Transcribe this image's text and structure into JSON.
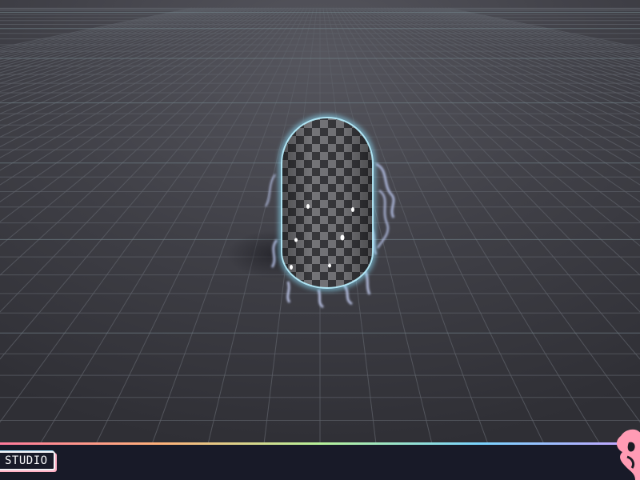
{
  "scene": {
    "floor_color": "#3c3c42",
    "grid_line_color": "#5d6068",
    "grid_accent_color": "#6f7f86",
    "capsule_checker_dark": "#3a3a3e",
    "capsule_checker_light": "#7a7a7e",
    "glow_color": "#8ee2ff",
    "wisp_color": "#bcc8f0"
  },
  "toolbar": {
    "background": "#181a28",
    "studio_label": "STUDIO",
    "gradient_colors": [
      "#ff7a9c",
      "#ffb27a",
      "#b7f29a",
      "#7ad4ff",
      "#c9a2ff"
    ]
  },
  "logo": {
    "icon": "pink-blob-logo-icon",
    "color": "#ff9bb4"
  }
}
